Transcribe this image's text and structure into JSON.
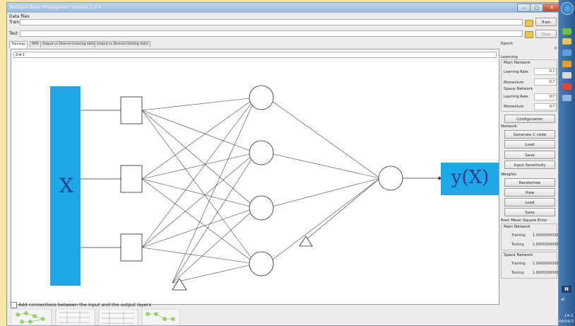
{
  "window": {
    "title": "Multiple Back Propagation Version 2.2.4"
  },
  "data_files": {
    "group_label": "Data files",
    "train_label": "Train",
    "train_value": "",
    "test_label": "Test",
    "test_value": "",
    "train_button": "Train",
    "stop_button": "Stop"
  },
  "tabs": [
    {
      "label": "Topology"
    },
    {
      "label": "RMS"
    },
    {
      "label": "Output vs Desired (training data)"
    },
    {
      "label": "Output vs Desired (testing data)"
    }
  ],
  "topology": {
    "value": "3-4-1"
  },
  "network_diagram": {
    "input_label": "X",
    "output_label": "y(X)"
  },
  "add_connections": {
    "label": "Add connections between the input and the output layers",
    "checked": false
  },
  "side": {
    "epoch_label": "Epoch",
    "epoch_value": "0",
    "learning_label": "Learning",
    "main_network_label": "Main Network",
    "learning_rate_label": "Learning Rate",
    "main_learning_rate": "0.7",
    "momentum_label": "Momentum",
    "main_momentum": "0.7",
    "space_network_label": "Space Network",
    "space_learning_rate": "0.7",
    "space_momentum": "0.7",
    "configuration_button": "Configuration",
    "network_label": "Network",
    "generate_c_button": "Generate C code",
    "load_button": "Load",
    "save_button": "Save",
    "input_sensitivity_button": "Input Sensitivity",
    "weights_label": "Weights",
    "randomize_button": "Randomize",
    "view_button": "View",
    "rms_label": "Root Mean Square Error",
    "mse_main_label": "Main Network",
    "training_label": "Training",
    "testing_label": "Testing",
    "main_training_value": "1.0000000000",
    "main_testing_value": "1.0000000000",
    "mse_space_label": "Space Network",
    "space_training_value": "1.0000000000",
    "space_testing_value": "1.0000000000"
  },
  "taskbar": {
    "clock_time": "14:3",
    "clock_date": "04/04/2"
  }
}
